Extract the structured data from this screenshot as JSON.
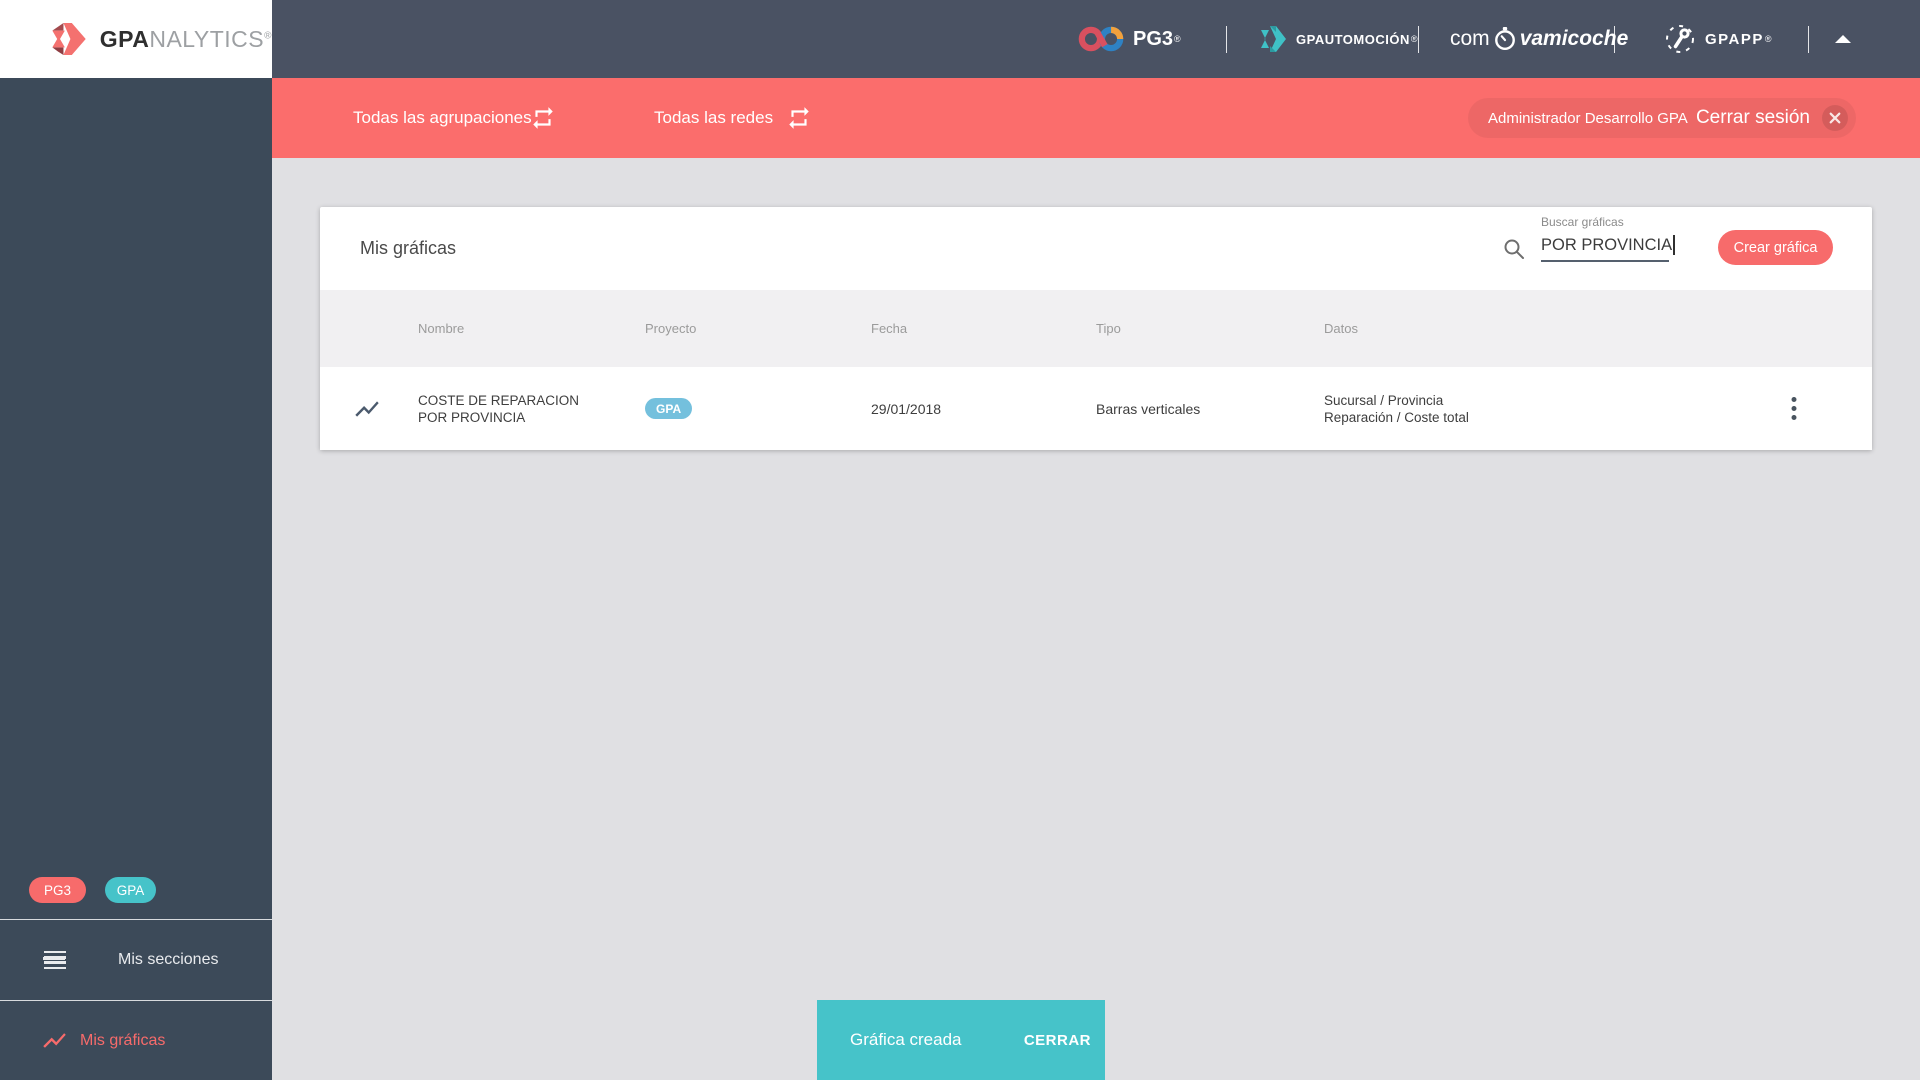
{
  "brand": {
    "bold": "GPA",
    "light": "NALYTICS",
    "reg": "®"
  },
  "topbar": {
    "pg3": "PG3",
    "pg3_sup": "®",
    "gpautomocion": "GPAUTOMOCIÓN",
    "gpautomocion_sup": "®",
    "como_pre": "com",
    "como_post": "vamicoche",
    "gpaapp": "GPAPP",
    "gpaapp_sup": "®"
  },
  "filterbar": {
    "agrupaciones": "Todas las agrupaciones",
    "redes": "Todas las redes",
    "user": "Administrador Desarrollo GPA",
    "logout": "Cerrar sesión"
  },
  "sidebar": {
    "badge_pg3": "PG3",
    "badge_gpa": "GPA",
    "item_secciones": "Mis secciones",
    "item_graficas": "Mis gráficas"
  },
  "card": {
    "title": "Mis gráficas",
    "search_label": "Buscar gráficas",
    "search_value": "POR PROVINCIA",
    "create_button": "Crear gráfica",
    "columns": [
      "Nombre",
      "Proyecto",
      "Fecha",
      "Tipo",
      "Datos"
    ],
    "row": {
      "name": "COSTE DE REPARACION POR PROVINCIA",
      "project": "GPA",
      "date": "29/01/2018",
      "type": "Barras verticales",
      "data_line1": "Sucursal / Provincia",
      "data_line2": "Reparación / Coste total"
    }
  },
  "toast": {
    "message": "Gráfica creada",
    "action": "CERRAR"
  },
  "colors": {
    "topbar": "#4a5263",
    "sidebar": "#3c4a59",
    "accent_red": "#fb6d6c",
    "accent_teal": "#46c3c9",
    "badge_blue": "#74c0dd",
    "page_bg": "#e0e0e3"
  }
}
